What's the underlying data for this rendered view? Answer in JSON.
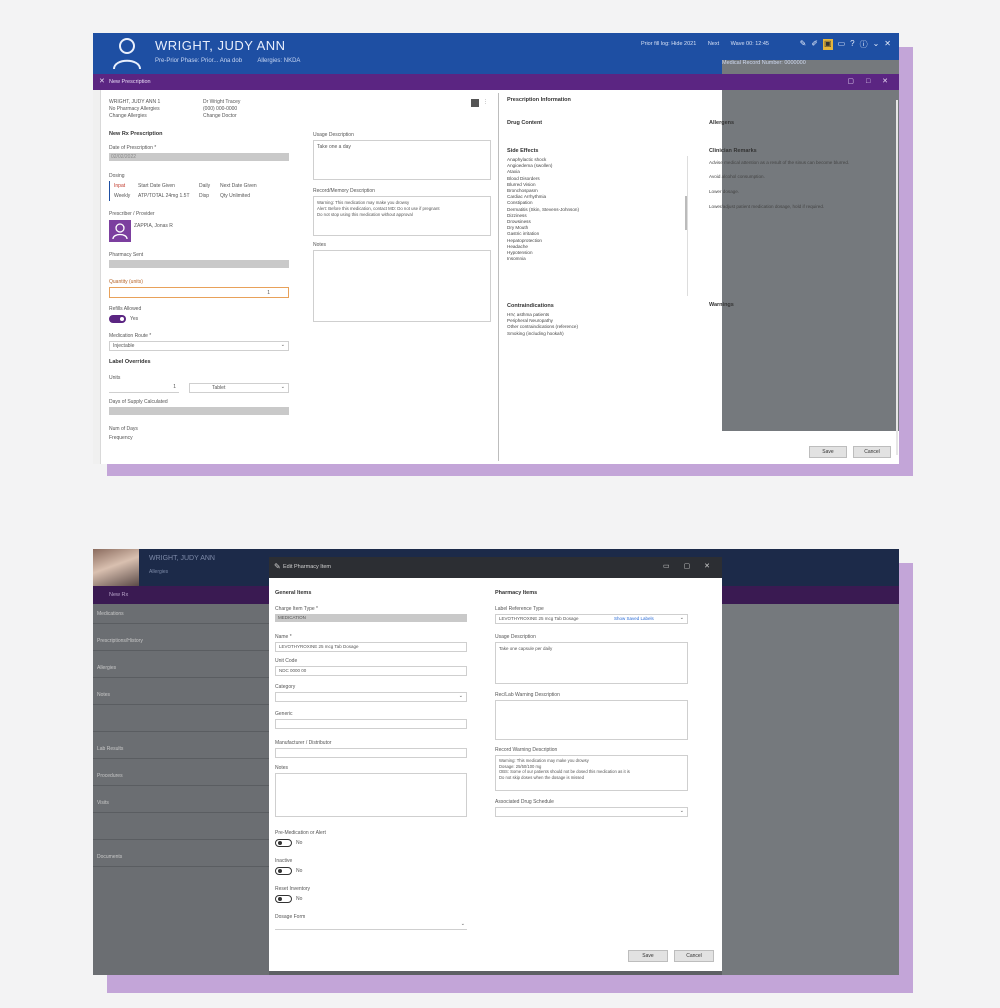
{
  "shot1": {
    "header": {
      "name": "WRIGHT, JUDY ANN",
      "sub_left": "Pre-Prior Phase: Prior... Ana dob",
      "sub_right": "Allergies: NKDA",
      "meta": [
        "Prior fill log: Hide 2021",
        "Next",
        "Wave 00: 12:45"
      ],
      "icons": [
        "edit-icon",
        "pen-icon",
        "highlighted-icon",
        "window-icon",
        "help-icon",
        "info-icon",
        "collapse-icon",
        "close-icon"
      ],
      "right_sub": "Medical Record Number: 0000000",
      "color": "#1e4fa3"
    },
    "panel_bar": {
      "title": "New Prescription",
      "close": "✕",
      "window_controls": "▢ □ ✕",
      "color": "#5b2582"
    },
    "patient": {
      "line1a": "WRIGHT, JUDY ANN 1",
      "line1b": "No Pharmacy Allergies",
      "line1c": "Change Allergies",
      "line2a": "Dr Wright Tracey",
      "line2b": "(000) 000-0000",
      "line2c": "Change Doctor"
    },
    "form": {
      "section": "New Rx Prescription",
      "date_label": "Date of Prescription *",
      "date_value": "02/02/2022",
      "drug_label": "Dosing",
      "drug_rows": [
        {
          "a": "Inpat",
          "b": "Start Date Given",
          "c": "Daily",
          "d": "Next Date Given"
        },
        {
          "a": "Weekly",
          "b": "ATP/TOTAL 24mg 1.5T",
          "c": "Disp",
          "d": "Qty Unlimited"
        }
      ],
      "prescriber_label": "Prescriber / Provider",
      "prescriber_value": "ZAPPIA, Jonas R",
      "pharmacy_label": "Pharmacy Sent",
      "quantity_label": "Quantity (units)",
      "quantity_value": "1",
      "refill_label": "Refills Allowed",
      "refill_toggle": "Yes",
      "route_label": "Medication Route *",
      "route_value": "Injectable",
      "label_section": "Label Overrides",
      "units_label": "Units",
      "units_value": "1",
      "units_unit": "Tablet",
      "days_label": "Days of Supply Calculated",
      "num_days_label": "Num of Days",
      "num_days_value": "Frequency"
    },
    "middle": {
      "usage_label": "Usage Description",
      "usage_value": "Take one a day",
      "record_label": "Record/Memory Description",
      "record_lines": [
        "Warning: This medication may make you drowsy",
        "Alert: Before this medication, contact MD: Do not use if pregnant",
        "Do not stop using this medication without approval"
      ],
      "notes_label": "Notes"
    },
    "right": {
      "title": "Prescription Information",
      "drug_content": "Drug Content",
      "allergens": "Allergens",
      "side_effects_title": "Side Effects",
      "side_effects": [
        "Anaphylactic shock",
        "Angioedema (swollen)",
        "Ataxia",
        "Blood Disorders",
        "Blurred Vision",
        "Bronchospasm",
        "Cardiac Arrhythmia",
        "Constipation",
        "Dermatitis (Skin, Stevens-Johnson)",
        "Dizziness",
        "Drowsiness",
        "Dry Mouth",
        "Gastric irritation",
        "Hepatoprotection",
        "Headache",
        "Hypotension",
        "Insomnia"
      ],
      "contra_title": "Contraindications",
      "contraindications": [
        "HIV, asthma patients",
        "Peripheral Neuropathy",
        "Other contraindications (reference)",
        "Smoking (including hookah)"
      ],
      "notes_title": "Clinician Remarks",
      "notes": [
        "Advise medical attention as a result of the sinus can become blurred.",
        "Avoid alcohol consumption.",
        "Lower dosage.",
        "Lower/adjust patient medication dosage, hold if required."
      ],
      "warnings": "Warnings",
      "save": "Save",
      "cancel": "Cancel"
    }
  },
  "shot2": {
    "header_name": "WRIGHT, JUDY ANN",
    "header_sub": "Allergies",
    "panel_title": "New Rx",
    "sidebar": [
      "Medications",
      "Prescriptions/History",
      "Allergies",
      "Notes",
      "",
      "Lab Results",
      "Procedures",
      "Visits",
      "",
      "Documents"
    ],
    "dialog": {
      "title": "Edit Pharmacy Item",
      "left_heading": "General Items",
      "fields": [
        {
          "label": "Charge Item Type *",
          "value": "MEDICATION"
        },
        {
          "label": "Name *",
          "value": "LEVOTHYROXINE 25 mcg Tab Dosage"
        },
        {
          "label": "Unit Code",
          "value": "NDC 0000 00"
        },
        {
          "label": "Category",
          "value": ""
        },
        {
          "label": "Generic",
          "value": ""
        },
        {
          "label": "Manufacturer / Distributor",
          "value": ""
        },
        {
          "label": "Notes",
          "value": ""
        }
      ],
      "toggles": [
        {
          "label": "Pre-Medication or Alert",
          "value": "No"
        },
        {
          "label": "Inactive",
          "value": "No"
        },
        {
          "label": "Reset Inventory",
          "value": "No"
        }
      ],
      "last_label": "Dosage Form",
      "right_heading": "Pharmacy Items",
      "label_label": "Label Reference Type",
      "label_value": "LEVOTHYROXINE 25 mcg Tab Dosage",
      "label_link": "Show Saved Labels",
      "usage_label": "Usage Description",
      "usage_value": "Take one capsule per daily",
      "record_label": "Rec/Lab Warning Description",
      "warning_label": "Record Warning Description",
      "warning_lines": [
        "Warning: This medication may make you drowsy",
        "Dosage: 25/50/100 mg",
        "OBS: Some of our patients should not be dosed this medication as it is",
        "Do not skip doses when the dosage is missed"
      ],
      "drug_schedule_label": "Associated Drug Schedule",
      "save": "Save",
      "cancel": "Cancel"
    }
  }
}
